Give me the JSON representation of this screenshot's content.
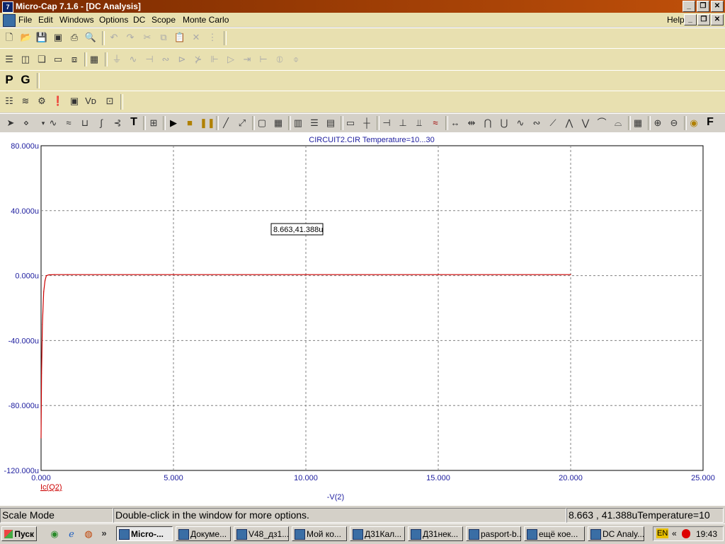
{
  "window": {
    "title": "Micro-Cap 7.1.6 - [DC Analysis]",
    "app_icon": "microcap-icon"
  },
  "menu": {
    "items": [
      "File",
      "Edit",
      "Windows",
      "Options",
      "DC",
      "Scope",
      "Monte Carlo"
    ],
    "help": "Help"
  },
  "toolbar3": {
    "p_label": "P",
    "g_label": "G"
  },
  "graphbar": {
    "text_tool": "T",
    "font_tool": "F"
  },
  "plot": {
    "title": "CIRCUIT2.CIR Temperature=10...30",
    "tooltip": "8.663,41.388u",
    "y_label_trace": "Ic(Q2)",
    "x_label": "-V(2)"
  },
  "chart_data": {
    "type": "line",
    "title": "CIRCUIT2.CIR Temperature=10...30",
    "xlabel": "-V(2)",
    "ylabel": "Ic(Q2)",
    "xlim": [
      0,
      25
    ],
    "ylim": [
      -120,
      80
    ],
    "x_ticks": [
      "0.000",
      "5.000",
      "10.000",
      "15.000",
      "20.000",
      "25.000"
    ],
    "y_ticks": [
      "80.000u",
      "40.000u",
      "0.000u",
      "-40.000u",
      "-80.000u",
      "-120.000u"
    ],
    "grid": true,
    "series": [
      {
        "name": "Ic(Q2)",
        "color": "#cc0000",
        "x": [
          0,
          0.02,
          0.05,
          0.1,
          0.15,
          0.2,
          0.3,
          0.5,
          1,
          5,
          10,
          15,
          20
        ],
        "y": [
          -100,
          -60,
          -30,
          -10,
          -3,
          0,
          0.5,
          0.6,
          0.6,
          0.6,
          0.6,
          0.6,
          0.6
        ]
      }
    ]
  },
  "status": {
    "mode": "Scale Mode",
    "hint": "Double-click in the window for more options.",
    "readout": "8.663 , 41.388uTemperature=10"
  },
  "taskbar": {
    "start": "Пуск",
    "tasks": [
      "Micro-...",
      "Докуме...",
      "V48_дз1...",
      "Мой ко...",
      "Д31Кал...",
      "Д31нек...",
      "pasport-b...",
      "ещё кое...",
      "DC Analy..."
    ],
    "lang": "EN",
    "clock": "19:43"
  }
}
